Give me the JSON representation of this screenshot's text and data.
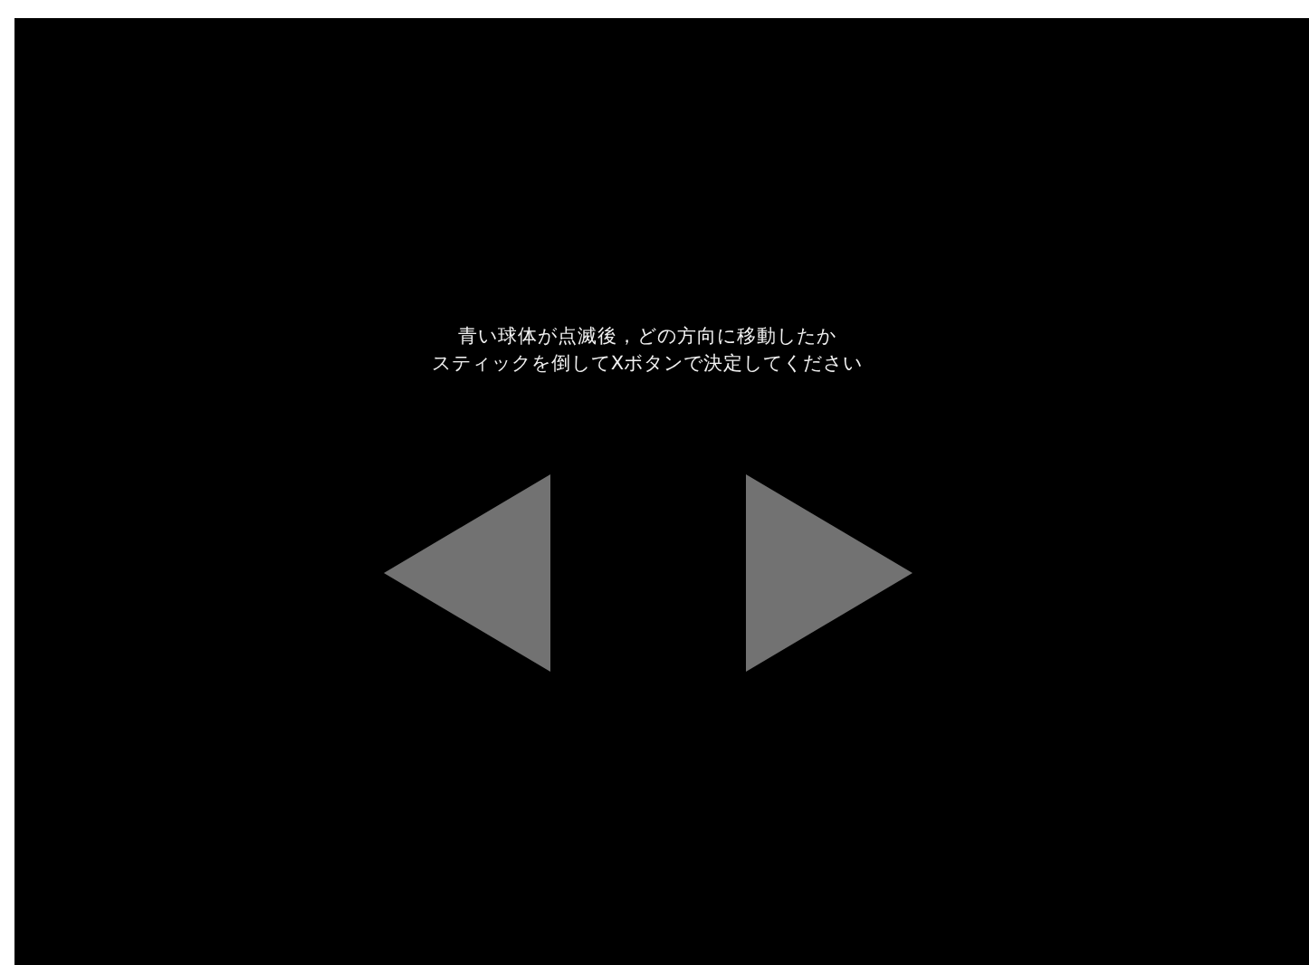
{
  "instructions": [
    "青い球体が点滅後，どの方向に移動したか",
    "スティックを倒してXボタンで決定してください"
  ],
  "arrows": [
    {
      "kind": "left"
    },
    {
      "kind": "right"
    }
  ]
}
